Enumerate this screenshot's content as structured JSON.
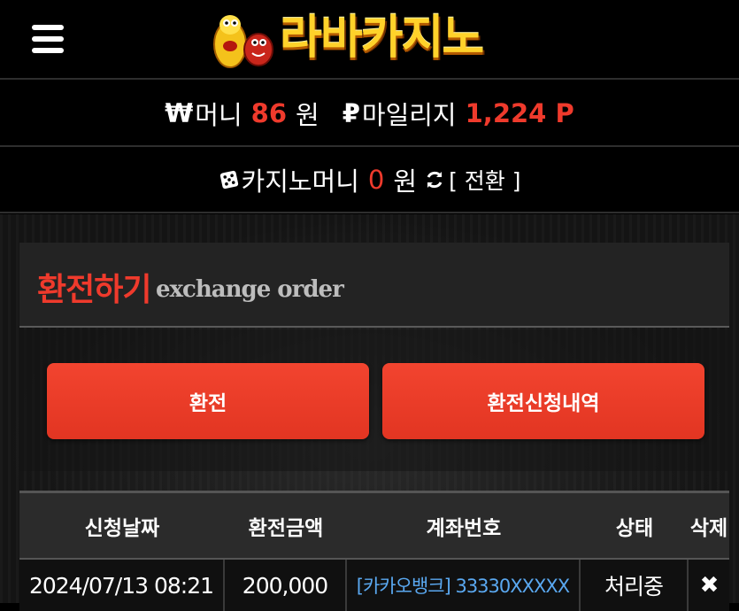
{
  "header": {
    "logo_text": "라바카지노"
  },
  "balance": {
    "money_symbol": "₩",
    "money_label": "머니",
    "money_value": "86",
    "money_unit": "원",
    "mileage_symbol": "₽",
    "mileage_label": "마일리지",
    "mileage_value": "1,224 P",
    "casino_label": "카지노머니",
    "casino_value": "0",
    "casino_unit": "원",
    "convert_label": "[ 전환 ]"
  },
  "panel": {
    "title_ko": "환전하기",
    "title_en": "exchange order",
    "exchange_button": "환전",
    "history_button": "환전신청내역"
  },
  "table": {
    "headers": [
      "신청날짜",
      "환전금액",
      "계좌번호",
      "상태",
      "삭제"
    ],
    "rows": [
      {
        "date": "2024/07/13 08:21",
        "amount": "200,000",
        "account": "[카카오뱅크] 33330XXXXX",
        "status": "처리중",
        "delete_icon": "✖"
      }
    ]
  },
  "colors": {
    "accent": "#ef3a2c",
    "button": "#e8392a",
    "link": "#5aa8f0",
    "logo": "#ffd22a"
  },
  "icons": [
    "menu-icon",
    "dice-icon",
    "refresh-icon",
    "delete-icon"
  ]
}
